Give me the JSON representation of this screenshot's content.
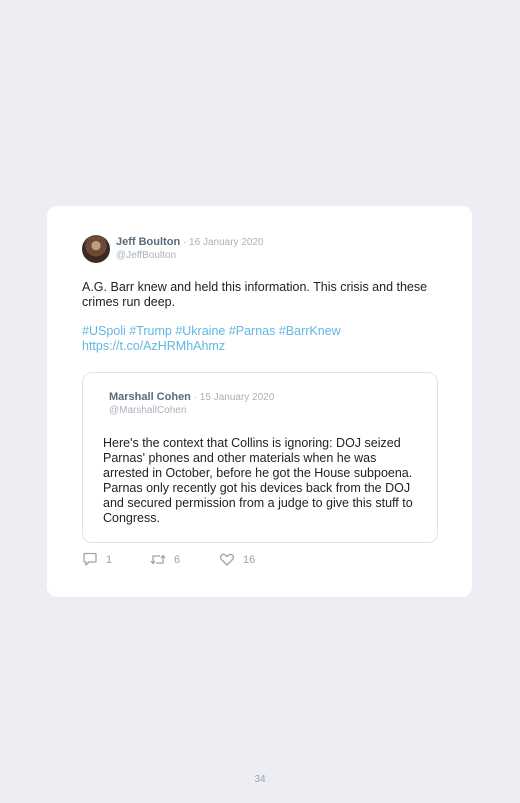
{
  "tweet": {
    "author_name": "Jeff Boulton",
    "date": " · 16 January 2020",
    "handle": "@JeffBoulton",
    "text": "A.G. Barr knew and held this information. This crisis and these crimes run deep.",
    "hashtags": "#USpoli #Trump #Ukraine #Parnas #BarrKnew",
    "link": "https://t.co/AzHRMhAhmz",
    "quoted": {
      "author_name": "Marshall Cohen",
      "date": " · 15 January 2020",
      "handle": "@MarshallCohen",
      "text": "Here's the context that Collins is ignoring: DOJ seized Parnas' phones and other materials when he was arrested in October, before he got the House subpoena. Parnas only recently got his devices back from the DOJ and secured permission from a judge to give this stuff to Congress."
    },
    "actions": {
      "replies": "1",
      "retweets": "6",
      "likes": "16"
    }
  },
  "page_number": "34",
  "icons": {
    "reply": "reply-icon",
    "retweet": "retweet-icon",
    "like": "heart-icon"
  },
  "colors": {
    "background": "#eceef3",
    "card": "#ffffff",
    "link": "#62b6e0",
    "muted": "#a8b2bd",
    "name": "#5a6b7b"
  }
}
